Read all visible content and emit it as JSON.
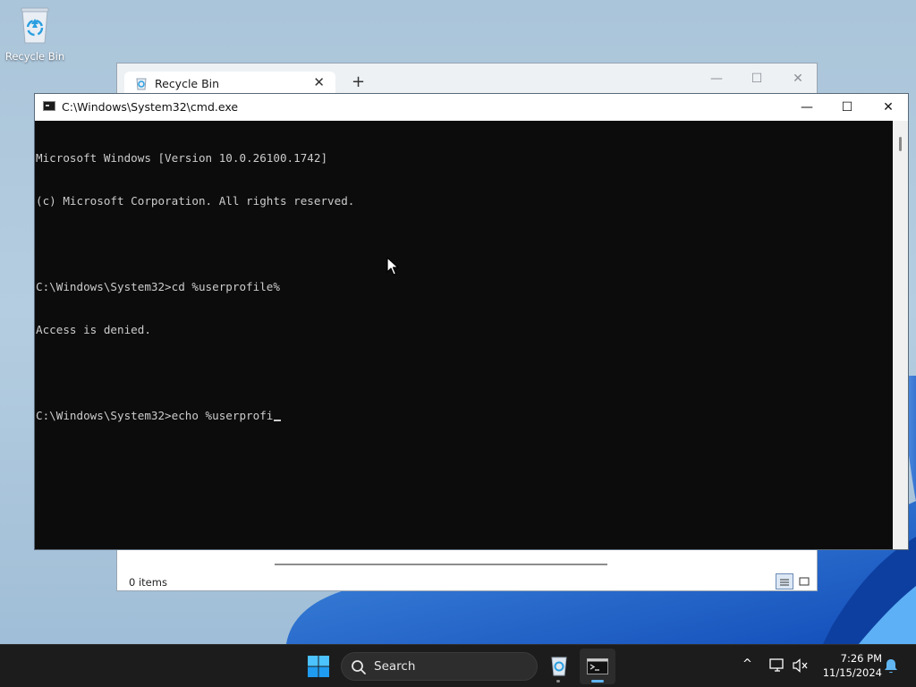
{
  "desktop": {
    "recycle_bin_label": "Recycle Bin"
  },
  "explorer": {
    "tab_title": "Recycle Bin",
    "tab_close": "✕",
    "new_tab": "+",
    "minimize": "—",
    "maximize": "☐",
    "close": "✕",
    "status_items": "0 items"
  },
  "cmd": {
    "title": "C:\\Windows\\System32\\cmd.exe",
    "minimize": "—",
    "maximize": "☐",
    "close": "✕",
    "lines": [
      "Microsoft Windows [Version 10.0.26100.1742]",
      "(c) Microsoft Corporation. All rights reserved.",
      "",
      "C:\\Windows\\System32>cd %userprofile%",
      "Access is denied.",
      "",
      "C:\\Windows\\System32>echo %userprofi"
    ],
    "text_color": "#cccccc",
    "background": "#0c0c0c"
  },
  "taskbar": {
    "search_label": "Search",
    "time": "7:26 PM",
    "date": "11/15/2024",
    "tray_chevron": "^",
    "accent": "#61b5f0"
  }
}
